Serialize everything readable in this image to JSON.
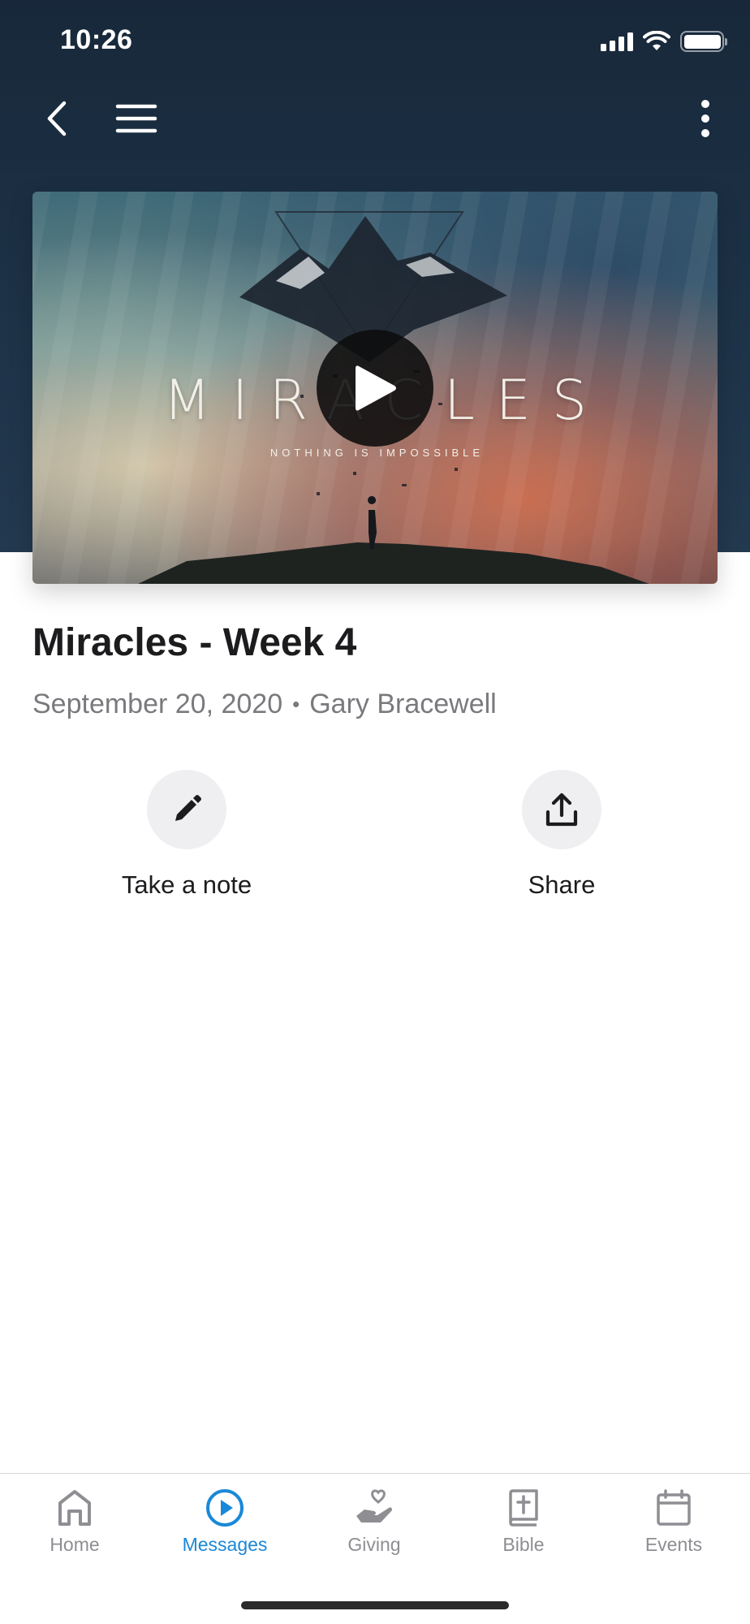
{
  "status_bar": {
    "time": "10:26"
  },
  "video": {
    "title_art": "MIRACLES",
    "subtitle_art": "NOTHING IS IMPOSSIBLE"
  },
  "message": {
    "title": "Miracles - Week 4",
    "date": "September 20, 2020",
    "separator": "•",
    "speaker": "Gary Bracewell"
  },
  "actions": [
    {
      "label": "Take a note",
      "icon": "pencil-icon"
    },
    {
      "label": "Share",
      "icon": "share-icon"
    }
  ],
  "tabbar": {
    "active": "Messages",
    "accent_color": "#1a88d8",
    "items": [
      {
        "label": "Home",
        "icon": "home-icon"
      },
      {
        "label": "Messages",
        "icon": "play-circle-icon"
      },
      {
        "label": "Giving",
        "icon": "giving-hand-icon"
      },
      {
        "label": "Bible",
        "icon": "bible-icon"
      },
      {
        "label": "Events",
        "icon": "calendar-icon"
      }
    ]
  }
}
